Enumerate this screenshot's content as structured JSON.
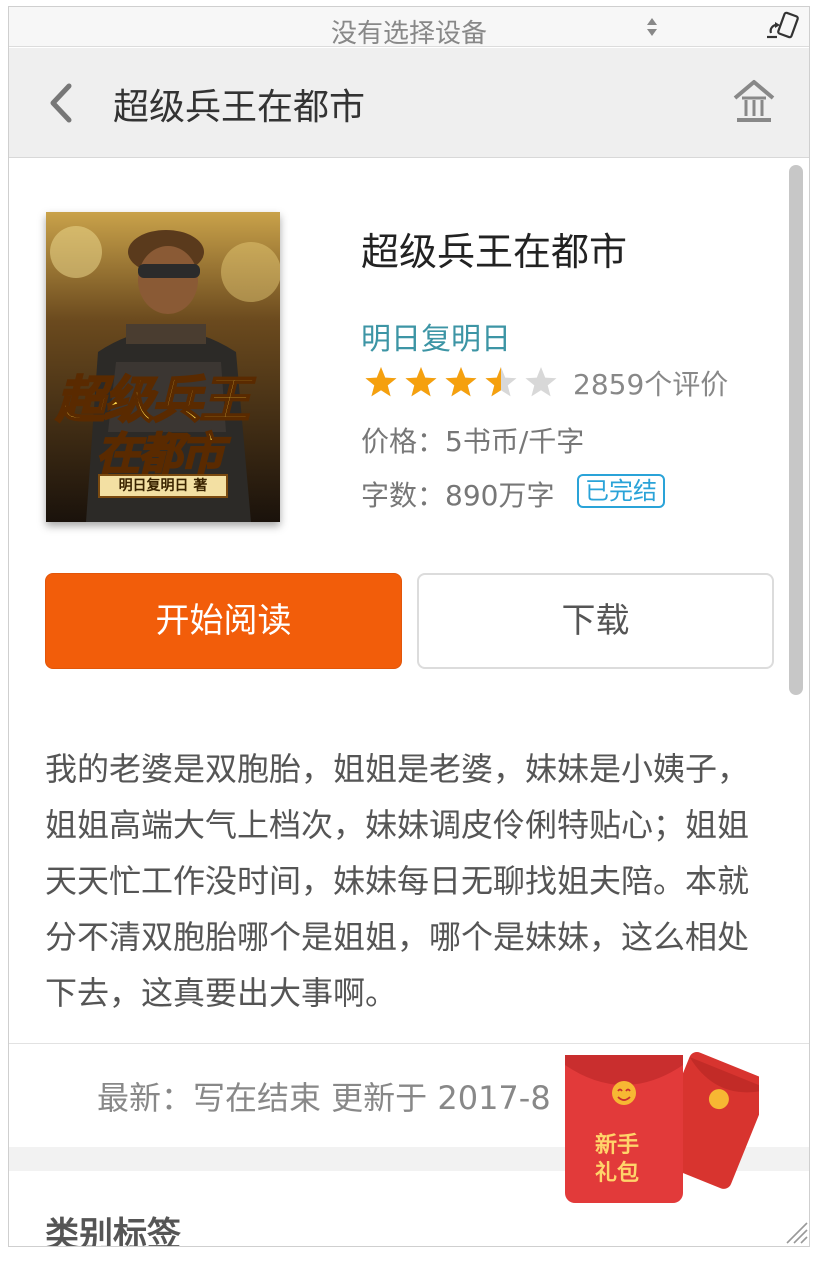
{
  "device_bar": {
    "label": "没有选择设备",
    "sort_icon": "sort-arrows-icon",
    "rotate_icon": "rotate-device-icon"
  },
  "header": {
    "title": "超级兵王在都市",
    "back_icon": "back-arrow-icon",
    "home_icon": "home-icon"
  },
  "book": {
    "title": "超级兵王在都市",
    "author": "明日复明日",
    "rating": 3.5,
    "rating_max": 5,
    "reviews": "2859个评价",
    "price": "价格：5书币/千字",
    "words": "字数：890万字",
    "status_badge": "已完结",
    "cover": {
      "title_line1": "超级兵王",
      "title_line2": "在都市",
      "author_plate": "明日复明日 著"
    }
  },
  "actions": {
    "read_label": "开始阅读",
    "download_label": "下载"
  },
  "description": "我的老婆是双胞胎，姐姐是老婆，妹妹是小姨子，姐姐高端大气上档次，妹妹调皮伶俐特贴心；姐姐天天忙工作没时间，妹妹每日无聊找姐夫陪。本就分不清双胞胎哪个是姐姐，哪个是妹妹，这么相处下去，这真要出大事啊。",
  "latest": "最新：写在结束 更新于 2017-8",
  "section": {
    "category_title": "类别标签"
  },
  "red_packet": {
    "line1": "新手",
    "line2": "礼包"
  },
  "colors": {
    "accent": "#f25d0a",
    "author": "#3d95a5",
    "badge": "#2aa3d8",
    "star": "#f5a00e",
    "star_empty": "#d8d8d8",
    "packet_red": "#e23a3a"
  }
}
